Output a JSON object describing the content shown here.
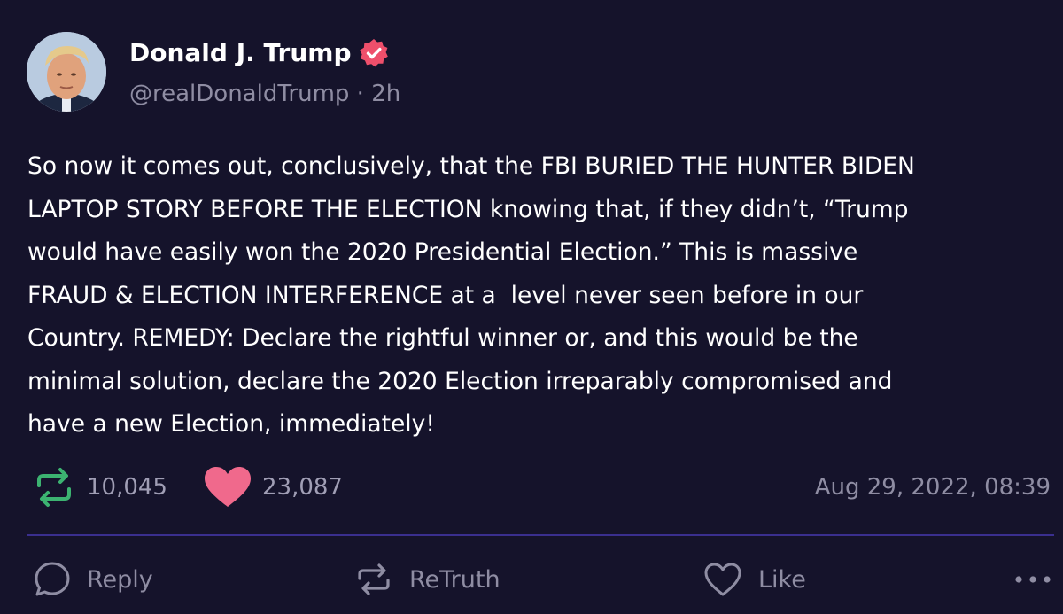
{
  "author": {
    "display_name": "Donald J. Trump",
    "handle_line": "@realDonaldTrump · 2h",
    "verified": true
  },
  "post": {
    "text": "So now it comes out, conclusively, that the FBI BURIED THE HUNTER BIDEN\nLAPTOP STORY BEFORE THE ELECTION knowing that, if they didn’t, “Trump\nwould have easily won the 2020 Presidential Election.” This is massive\nFRAUD & ELECTION INTERFERENCE at a  level never seen before in our\nCountry. REMEDY: Declare the rightful winner or, and this would be the\nminimal solution, declare the 2020 Election irreparably compromised and\nhave a new Election, immediately!"
  },
  "stats": {
    "retruths": "10,045",
    "likes": "23,087",
    "timestamp": "Aug 29, 2022, 08:39"
  },
  "actions": {
    "reply_label": "Reply",
    "retruth_label": "ReTruth",
    "like_label": "Like"
  },
  "colors": {
    "background": "#15132b",
    "retruth_green": "#3cb371",
    "like_pink": "#f0698c",
    "verified_pink": "#ee4f6b",
    "divider": "#3a2f8f",
    "muted_text": "#8f8da3"
  },
  "icons": {
    "verified": "verified-badge-icon",
    "retruth": "retruth-arrows-icon",
    "like": "heart-icon",
    "reply": "speech-bubble-icon",
    "more": "ellipsis-icon"
  }
}
